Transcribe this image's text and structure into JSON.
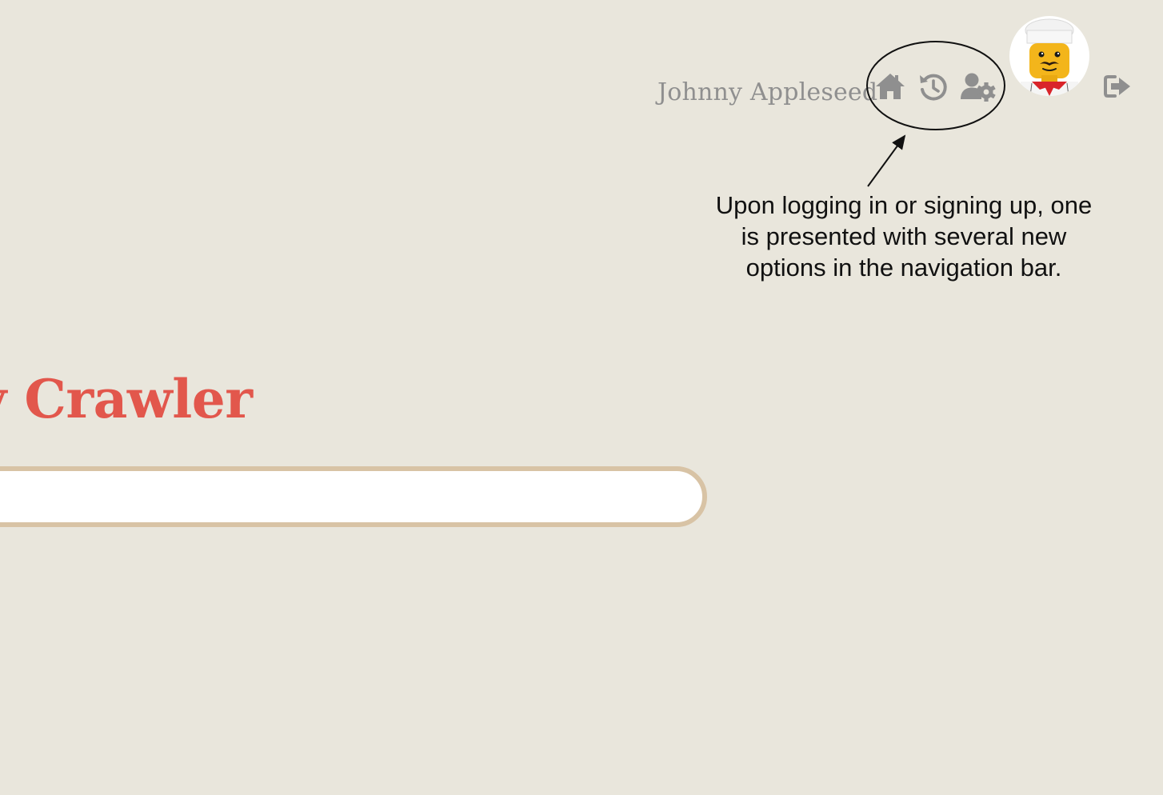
{
  "header": {
    "username": "Johnny Appleseed",
    "icons": [
      "home-icon",
      "history-icon",
      "user-settings-icon",
      "logout-icon"
    ],
    "icon_color": "#8f8f8f"
  },
  "annotation": {
    "text": "Upon logging in or signing up, one is presented with several new options in the navigation bar."
  },
  "main": {
    "title": "y Crawler",
    "title_color": "#e2574c",
    "search": {
      "value": "",
      "placeholder": ""
    }
  },
  "colors": {
    "background": "#e9e6dc",
    "search_border": "#d8c3a5"
  }
}
